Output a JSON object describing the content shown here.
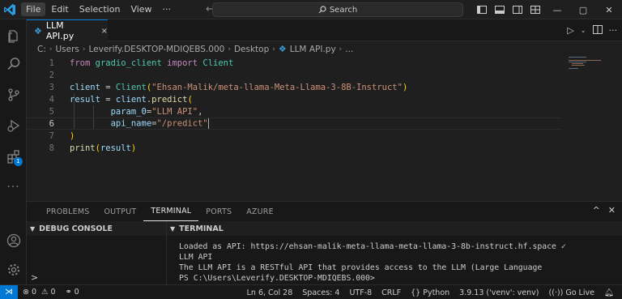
{
  "menu": [
    "File",
    "Edit",
    "Selection",
    "View",
    "···"
  ],
  "search": {
    "label": "Search"
  },
  "tab": {
    "title": "LLM API.py",
    "close": "×"
  },
  "breadcrumbs": [
    "C:",
    "Users",
    "Leverify.DESKTOP-MDIQEBS.000",
    "Desktop",
    "LLM API.py",
    "..."
  ],
  "editor": {
    "line_numbers": [
      "1",
      "2",
      "3",
      "4",
      "5",
      "6",
      "7",
      "8"
    ],
    "lines": [
      [
        {
          "t": "from",
          "c": "kw"
        },
        {
          "t": " gradio_client ",
          "c": "mod"
        },
        {
          "t": "import",
          "c": "kw"
        },
        {
          "t": " Client",
          "c": "cls"
        }
      ],
      [],
      [
        {
          "t": "client",
          "c": "var"
        },
        {
          "t": " = ",
          "c": "pun"
        },
        {
          "t": "Client",
          "c": "cls"
        },
        {
          "t": "(",
          "c": "brk"
        },
        {
          "t": "\"Ehsan-Malik/meta-llama-Meta-Llama-3-8B-Instruct\"",
          "c": "str"
        },
        {
          "t": ")",
          "c": "brk"
        }
      ],
      [
        {
          "t": "result",
          "c": "var"
        },
        {
          "t": " = ",
          "c": "pun"
        },
        {
          "t": "client",
          "c": "var"
        },
        {
          "t": ".",
          "c": "pun"
        },
        {
          "t": "predict",
          "c": "fn"
        },
        {
          "t": "(",
          "c": "brk"
        }
      ],
      [
        {
          "t": "        ",
          "c": "pun"
        },
        {
          "t": "param_0",
          "c": "var"
        },
        {
          "t": "=",
          "c": "pun"
        },
        {
          "t": "\"LLM API\"",
          "c": "str"
        },
        {
          "t": ",",
          "c": "pun"
        }
      ],
      [
        {
          "t": "        ",
          "c": "pun"
        },
        {
          "t": "api_name",
          "c": "var"
        },
        {
          "t": "=",
          "c": "pun"
        },
        {
          "t": "\"/predict\"",
          "c": "str"
        }
      ],
      [
        {
          "t": ")",
          "c": "brk"
        }
      ],
      [
        {
          "t": "print",
          "c": "fn"
        },
        {
          "t": "(",
          "c": "brk"
        },
        {
          "t": "result",
          "c": "var"
        },
        {
          "t": ")",
          "c": "brk"
        }
      ]
    ]
  },
  "panel": {
    "tabs": [
      "PROBLEMS",
      "OUTPUT",
      "TERMINAL",
      "PORTS",
      "AZURE"
    ],
    "active_tab": "TERMINAL",
    "debug_header": "DEBUG CONSOLE",
    "debug_prompt": ">",
    "terminal_header": "TERMINAL",
    "terminal_lines": [
      "Loaded as API: https://ehsan-malik-meta-llama-meta-llama-3-8b-instruct.hf.space ✓",
      "LLM API",
      "The LLM API is a RESTful API that provides access to the LLM (Large Language",
      "PS C:\\Users\\Leverify.DESKTOP-MDIQEBS.000>"
    ]
  },
  "status": {
    "remote": "⋊",
    "errors": "0",
    "warnings": "0",
    "ports": "0",
    "position": "Ln 6, Col 28",
    "spaces": "Spaces: 4",
    "encoding": "UTF-8",
    "eol": "CRLF",
    "language": "Python",
    "interpreter": "3.9.13 ('venv': venv)",
    "golive": "Go Live"
  },
  "activity_badge": "1",
  "colors": {
    "accent": "#0078d4",
    "string": "#ce9178",
    "keyword": "#c586c0",
    "class": "#4ec9b0",
    "variable": "#9cdcfe",
    "function": "#dcdcaa"
  }
}
